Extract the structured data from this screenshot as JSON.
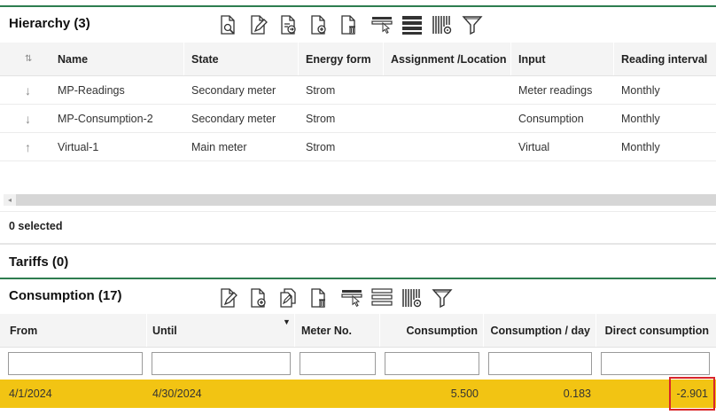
{
  "hierarchy": {
    "title": "Hierarchy (3)",
    "toolbar": [
      "view-document-icon",
      "edit-document-icon",
      "import-document-icon",
      "add-document-icon",
      "delete-document-icon",
      "select-cursor-icon",
      "list-lines-icon",
      "column-settings-icon",
      "filter-icon"
    ],
    "sort_icon": "⇅",
    "columns": [
      "Name",
      "State",
      "Energy form",
      "Assignment /Location",
      "Input",
      "Reading interval"
    ],
    "rows": [
      {
        "dir": "↓",
        "name": "MP-Readings",
        "state": "Secondary meter",
        "energy": "Strom",
        "location": "",
        "input": "Meter readings",
        "interval": "Monthly"
      },
      {
        "dir": "↓",
        "name": "MP-Consumption-2",
        "state": "Secondary meter",
        "energy": "Strom",
        "location": "",
        "input": "Consumption",
        "interval": "Monthly"
      },
      {
        "dir": "↑",
        "name": "Virtual-1",
        "state": "Main meter",
        "energy": "Strom",
        "location": "",
        "input": "Virtual",
        "interval": "Monthly"
      }
    ],
    "selected_text": "0 selected",
    "scroll_arrow": "◂"
  },
  "tariffs": {
    "title": "Tariffs (0)"
  },
  "consumption": {
    "title": "Consumption (17)",
    "toolbar": [
      "edit-document-icon",
      "add-document-icon",
      "copy-document-icon",
      "delete-document-icon",
      "select-cursor-icon",
      "list-lines-icon",
      "column-settings-icon",
      "filter-icon"
    ],
    "columns": [
      "From",
      "Until",
      "Meter No.",
      "Consumption",
      "Consumption / day",
      "Direct consumption"
    ],
    "sort_indicator": "▼",
    "rows": [
      {
        "from": "4/1/2024",
        "until": "4/30/2024",
        "meter": "",
        "consumption": "5.500",
        "per_day": "0.183",
        "direct": "-2.901"
      }
    ],
    "highlight_color": "#f2c413",
    "box_color": "#d9262a"
  },
  "colors": {
    "accent": "#2e7d4f"
  }
}
